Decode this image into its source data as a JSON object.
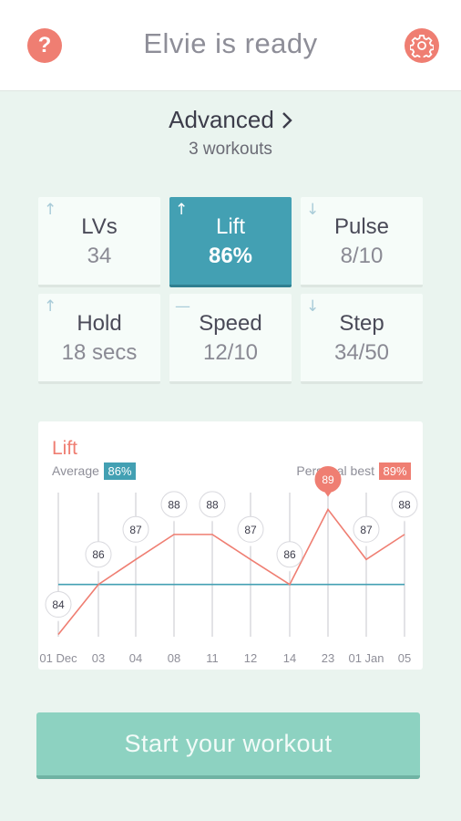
{
  "header": {
    "title": "Elvie is ready",
    "help_label": "?",
    "help_icon": "question-icon",
    "settings_icon": "gear-icon",
    "accent_color": "#ef7e72"
  },
  "level": {
    "title": "Advanced",
    "subtitle": "3 workouts",
    "chevron_icon": "chevron-right-icon"
  },
  "stats": [
    {
      "label": "LVs",
      "value": "34",
      "trend": "up",
      "active": false
    },
    {
      "label": "Lift",
      "value": "86%",
      "trend": "up",
      "active": true
    },
    {
      "label": "Pulse",
      "value": "8/10",
      "trend": "down",
      "active": false
    },
    {
      "label": "Hold",
      "value": "18 secs",
      "trend": "up",
      "active": false
    },
    {
      "label": "Speed",
      "value": "12/10",
      "trend": "flat",
      "active": false
    },
    {
      "label": "Step",
      "value": "34/50",
      "trend": "down",
      "active": false
    }
  ],
  "chart": {
    "title": "Lift",
    "average_label": "Average",
    "average_value": "86%",
    "best_label": "Personal best",
    "best_value": "89%"
  },
  "chart_data": {
    "type": "line",
    "title": "Lift",
    "categories": [
      "01 Dec",
      "03",
      "04",
      "08",
      "11",
      "12",
      "14",
      "23",
      "01 Jan",
      "05"
    ],
    "series": [
      {
        "values": [
          84,
          86,
          87,
          88,
          88,
          87,
          86,
          89,
          87,
          88
        ],
        "color": "#ef7e72"
      }
    ],
    "average": 86,
    "average_color": "#43a0b3",
    "personal_best": 89,
    "highlight_index": 7,
    "ylim": [
      83.4,
      89.6
    ],
    "grid": "vertical"
  },
  "cta": {
    "label": "Start your workout"
  }
}
